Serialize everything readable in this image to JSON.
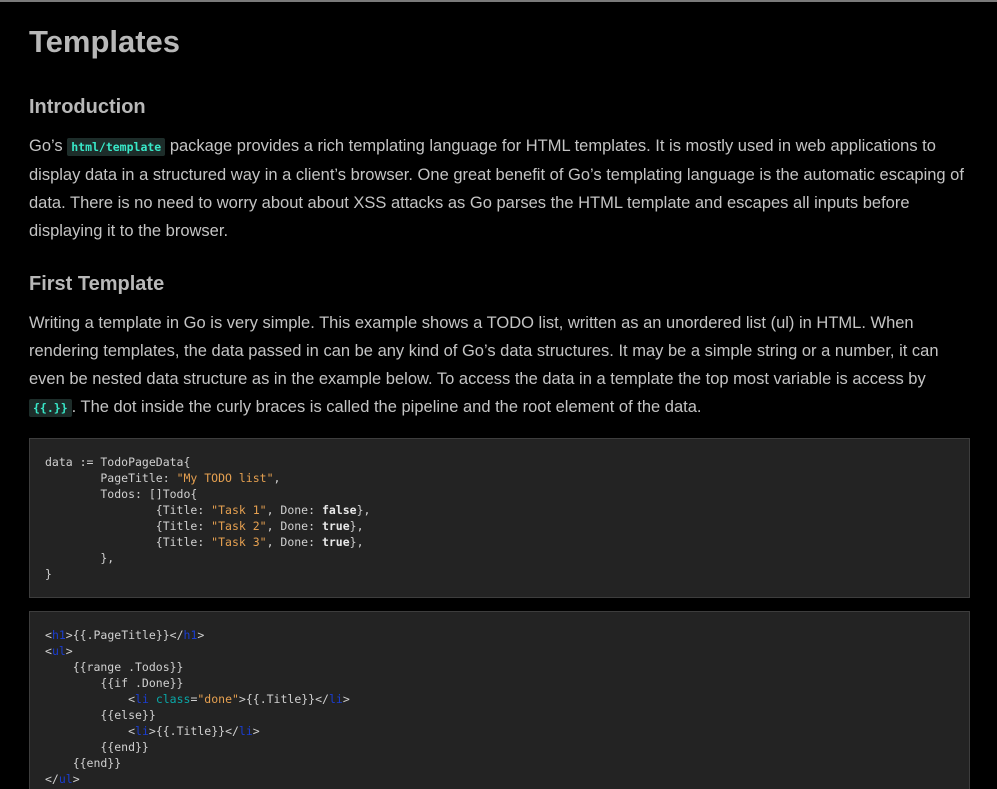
{
  "title": "Templates",
  "intro": {
    "heading": "Introduction",
    "p_before": "Go’s ",
    "code": "html/template",
    "p_after": " package provides a rich templating language for HTML templates. It is mostly used in web applications to display data in a structured way in a client’s browser. One great benefit of Go’s templating language is the automatic escaping of data. There is no need to worry about about XSS attacks as Go parses the HTML template and escapes all inputs before displaying it to the browser."
  },
  "first_template": {
    "heading": "First Template",
    "p_before": "Writing a template in Go is very simple. This example shows a TODO list, written as an unordered list (ul) in HTML. When rendering templates, the data passed in can be any kind of Go’s data structures. It may be a simple string or a number, it can even be nested data structure as in the example below. To access the data in a template the top most variable is access by ",
    "code": "{{.}}",
    "p_after": ". The dot inside the curly braces is called the pipeline and the root element of the data."
  },
  "code_go": {
    "line1": "data := TodoPageData{",
    "pagetitle_key": "        PageTitle: ",
    "pagetitle_val": "\"My TODO list\"",
    "pagetitle_end": ",",
    "todos": "        Todos: []Todo{",
    "items": [
      {
        "prefix": "                {Title: ",
        "title": "\"Task 1\"",
        "mid": ", Done: ",
        "done": "false",
        "end": "},"
      },
      {
        "prefix": "                {Title: ",
        "title": "\"Task 2\"",
        "mid": ", Done: ",
        "done": "true",
        "end": "},"
      },
      {
        "prefix": "                {Title: ",
        "title": "\"Task 3\"",
        "mid": ", Done: ",
        "done": "true",
        "end": "},"
      }
    ],
    "close_inner": "        },",
    "close_outer": "}"
  },
  "code_html": {
    "h1_open": "h1",
    "page_title_expr": "{{.PageTitle}}",
    "ul": "ul",
    "range": "    {{range .Todos}}",
    "if_done": "        {{if .Done}}",
    "li": "li",
    "class_attr": "class",
    "class_val": "\"done\"",
    "title_expr": "{{.Title}}",
    "else": "        {{else}}",
    "end_if": "        {{end}}",
    "end_range": "    {{end}}"
  },
  "colors": {
    "background": "#000000",
    "text": "#c4c4c4",
    "heading": "#b8b8b8",
    "inline_code": "#38e8c8",
    "code_bg": "#232323",
    "string": "#e5a050",
    "html_tag": "#1a3dd0",
    "html_attr": "#0aa7a7"
  }
}
